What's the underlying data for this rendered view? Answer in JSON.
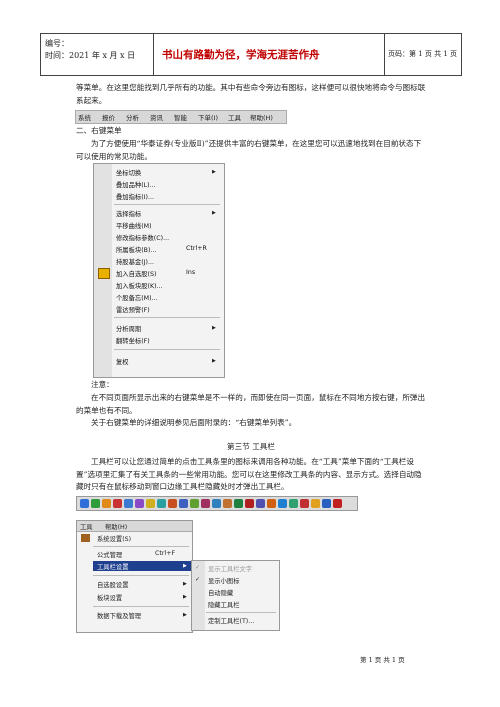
{
  "header": {
    "number_label": "编号：",
    "time_label": "时间：2021 年 x 月 x 日",
    "motto": "书山有路勤为径，学海无涯苦作舟",
    "page_label": "页码：第 1 页 共 1 页"
  },
  "intro_text": "等菜单。在这里您能找到几乎所有的功能。其中有些命令旁边有图标，这样便可以很快地将命令与图标联系起来。",
  "menubar": {
    "items": [
      "系统",
      "报价",
      "分析",
      "资讯",
      "智能",
      "下单(I)",
      "工具",
      "帮助(H)"
    ]
  },
  "section2_title": "二、右键菜单",
  "section2_text": "为了方便使用“华泰证券(专业版Ⅱ)”还提供丰富的右键菜单，在这里您可以迅速地找到在目前状态下可以使用的常见功能。",
  "context_menu": {
    "items": [
      {
        "label": "坐标切换",
        "submenu": true
      },
      {
        "label": "叠加品种(L)..."
      },
      {
        "label": "叠加指标(I)..."
      },
      {
        "label": "选择指标",
        "submenu": true
      },
      {
        "label": "平移曲线(M)"
      },
      {
        "label": "修改指标参数(C)..."
      },
      {
        "label": "所属板块(B)...",
        "shortcut": "Ctrl+R"
      },
      {
        "label": "持股基金(J)..."
      },
      {
        "label": "加入自选股(S)",
        "shortcut": "Ins"
      },
      {
        "label": "加入板块股(K)..."
      },
      {
        "label": "个股备忘(M)..."
      },
      {
        "label": "雷达预警(F)"
      },
      {
        "label": "分析周期",
        "submenu": true
      },
      {
        "label": "翻转坐标(F)"
      },
      {
        "label": "复权",
        "submenu": true
      }
    ]
  },
  "note_title": "注意：",
  "note_text": "在不同页面所显示出来的右键菜单是不一样的，而即使在同一页面，鼠标在不同地方按右键，所弹出的菜单也有不同。",
  "note_text2": "关于右键菜单的详细说明参见后面附录的：“右键菜单列表”。",
  "section3_title": "第三节 工具栏",
  "section3_text": "工具栏可以让您通过简单的点击工具条里的图标来调用各种功能。在“工具”菜单下面的“工具栏设置”选项里汇集了有关工具条的一些常用功能。您可以在这里修改工具条的内容、显示方式。选择自动隐藏时只有在鼠标移动到窗口边缘工具栏隐藏处时才弹出工具栏。",
  "tools_menu": {
    "bar_items": [
      "工具",
      "帮助(H)"
    ],
    "items": [
      {
        "label": "系统设置(S)"
      },
      {
        "label": "公式管理",
        "shortcut": "Ctrl+F"
      },
      {
        "label": "工具栏设置",
        "submenu": true,
        "highlighted": true
      },
      {
        "label": "自选股设置",
        "submenu": true
      },
      {
        "label": "板块设置",
        "submenu": true
      },
      {
        "label": "数据下载及管理",
        "submenu": true
      }
    ]
  },
  "toolbar_submenu": {
    "items": [
      {
        "label": "显示工具栏文字",
        "disabled": true
      },
      {
        "label": "显示小图标"
      },
      {
        "label": "自动隐藏"
      },
      {
        "label": "隐藏工具栏"
      },
      {
        "label": "定制工具栏(T)..."
      }
    ]
  },
  "footer": "第 1 页 共 1 页",
  "colors": {
    "motto": "#c00000",
    "highlight": "#1f3f8f"
  }
}
